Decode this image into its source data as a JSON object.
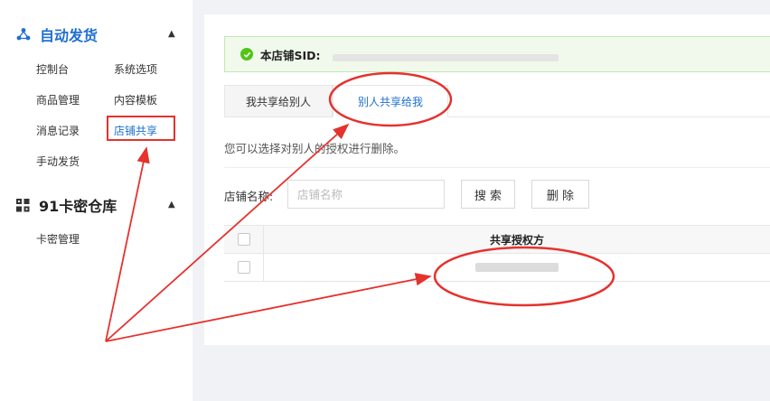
{
  "sidebar": {
    "groups": [
      {
        "title": "自动发货",
        "icon": "share-icon",
        "accent": "#1f6fd1",
        "items": [
          "控制台",
          "系统选项",
          "商品管理",
          "内容模板",
          "消息记录",
          "店铺共享",
          "手动发货"
        ]
      },
      {
        "title": "91卡密仓库",
        "icon": "grid-icon",
        "items": [
          "卡密管理"
        ]
      }
    ],
    "active_item": "店铺共享"
  },
  "main": {
    "sid_label": "本店铺SID:",
    "tabs": [
      "我共享给别人",
      "别人共享给我"
    ],
    "active_tab": "别人共享给我",
    "hint": "您可以选择对别人的授权进行删除。",
    "search": {
      "label": "店铺名称:",
      "placeholder": "店铺名称"
    },
    "buttons": {
      "search": "搜 索",
      "delete": "删 除"
    },
    "table": {
      "columns": [
        "共享授权方"
      ],
      "row_count": 1
    }
  },
  "colors": {
    "accent": "#1f6fd1",
    "success": "#52c41a",
    "annotation": "#e5322d"
  }
}
